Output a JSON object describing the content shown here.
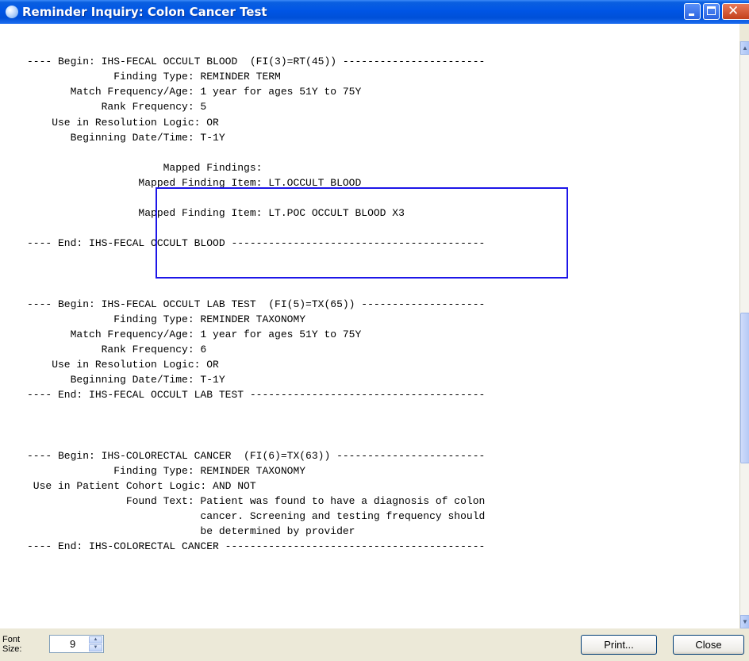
{
  "window": {
    "title": "Reminder Inquiry: Colon Cancer Test"
  },
  "report_lines": [
    "",
    "",
    "---- Begin: IHS-FECAL OCCULT BLOOD  (FI(3)=RT(45)) -----------------------",
    "              Finding Type: REMINDER TERM",
    "       Match Frequency/Age: 1 year for ages 51Y to 75Y",
    "            Rank Frequency: 5",
    "    Use in Resolution Logic: OR",
    "       Beginning Date/Time: T-1Y",
    "",
    "                      Mapped Findings:",
    "                  Mapped Finding Item: LT.OCCULT BLOOD",
    "",
    "                  Mapped Finding Item: LT.POC OCCULT BLOOD X3",
    "",
    "---- End: IHS-FECAL OCCULT BLOOD -----------------------------------------",
    "",
    "",
    "",
    "---- Begin: IHS-FECAL OCCULT LAB TEST  (FI(5)=TX(65)) --------------------",
    "              Finding Type: REMINDER TAXONOMY",
    "       Match Frequency/Age: 1 year for ages 51Y to 75Y",
    "            Rank Frequency: 6",
    "    Use in Resolution Logic: OR",
    "       Beginning Date/Time: T-1Y",
    "---- End: IHS-FECAL OCCULT LAB TEST --------------------------------------",
    "",
    "",
    "",
    "---- Begin: IHS-COLORECTAL CANCER  (FI(6)=TX(63)) ------------------------",
    "              Finding Type: REMINDER TAXONOMY",
    " Use in Patient Cohort Logic: AND NOT",
    "                Found Text: Patient was found to have a diagnosis of colon",
    "                            cancer. Screening and testing frequency should",
    "                            be determined by provider",
    "---- End: IHS-COLORECTAL CANCER ------------------------------------------"
  ],
  "font_size": {
    "label": "Font Size:",
    "value": "9"
  },
  "buttons": {
    "print": "Print...",
    "close": "Close"
  },
  "icons": {
    "app": "app-globe-icon",
    "minimize": "minimize-icon",
    "maximize": "maximize-icon",
    "close": "close-x-icon",
    "scroll_up": "scroll-up-icon",
    "scroll_down": "scroll-down-icon",
    "spin_up": "spin-up-icon",
    "spin_down": "spin-down-icon"
  },
  "colors": {
    "titlebar": "#0055e5",
    "highlight_box": "#1d16e8",
    "close_button": "#c3401c"
  }
}
